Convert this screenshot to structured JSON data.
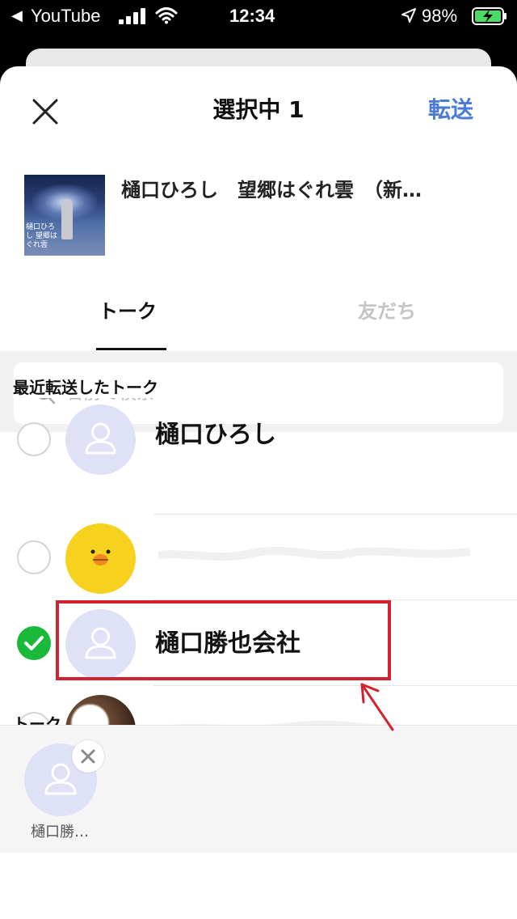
{
  "status_bar": {
    "back_arrow": "◀",
    "back_app": "YouTube",
    "time": "12:34",
    "battery_percent": "98%",
    "icons": [
      "signal-icon",
      "wifi-icon",
      "location-icon",
      "battery-charging-icon"
    ]
  },
  "header": {
    "title": "選択中 1",
    "send_label": "転送",
    "close_icon": "close-icon"
  },
  "media": {
    "title": "樋口ひろし　望郷はぐれ雲　（新…",
    "thumbnail_caption": "樋口ひろし 望郷はぐれ雲"
  },
  "tabs": [
    {
      "label": "トーク",
      "active": true
    },
    {
      "label": "友だち",
      "active": false
    }
  ],
  "search": {
    "placeholder": "名前で検索",
    "value": ""
  },
  "section_label": "最近転送したトーク",
  "lower_section_label": "トーク",
  "rows": [
    {
      "name": "樋口ひろし",
      "checked": false,
      "avatar": "default-person"
    },
    {
      "name": "",
      "checked": false,
      "avatar": "sally-duck"
    },
    {
      "name": "樋口勝也会社",
      "checked": true,
      "avatar": "default-person"
    },
    {
      "name": "",
      "checked": false,
      "avatar": "photo"
    }
  ],
  "selected_tray": {
    "items": [
      {
        "name": "樋口勝…"
      }
    ]
  },
  "colors": {
    "accent_blue": "#4a7bd6",
    "check_green": "#19b93a",
    "annotation_red": "#d0232f",
    "avatar_bg": "#dfe1f6"
  }
}
